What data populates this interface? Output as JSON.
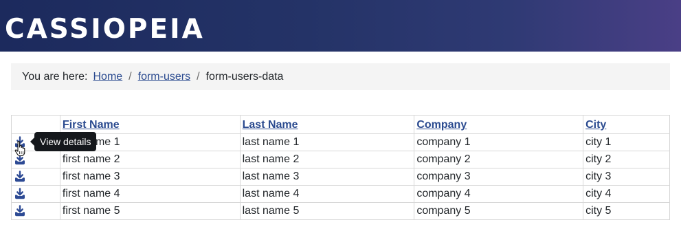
{
  "site": {
    "title": "CASSIOPEIA"
  },
  "breadcrumb": {
    "prefix": "You are here:",
    "items": [
      {
        "label": "Home",
        "link": true
      },
      {
        "label": "form-users",
        "link": true
      },
      {
        "label": "form-users-data",
        "link": false
      }
    ]
  },
  "table": {
    "columns": [
      "First Name",
      "Last Name",
      "Company",
      "City"
    ],
    "rows": [
      [
        "first name 1",
        "last name 1",
        "company 1",
        "city 1"
      ],
      [
        "first name 2",
        "last name 2",
        "company 2",
        "city 2"
      ],
      [
        "first name 3",
        "last name 3",
        "company 3",
        "city 3"
      ],
      [
        "first name 4",
        "last name 4",
        "company 4",
        "city 4"
      ],
      [
        "first name 5",
        "last name 5",
        "company 5",
        "city 5"
      ]
    ],
    "row_icon": "view-details-icon"
  },
  "tooltip": {
    "text": "View details"
  },
  "colors": {
    "header_start": "#1c2a5d",
    "header_end": "#4a3f86",
    "link": "#2a4a8f",
    "icon": "#2d4a94"
  }
}
